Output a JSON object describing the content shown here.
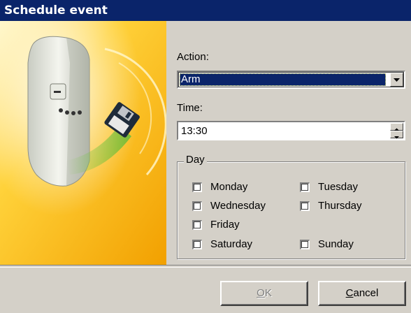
{
  "window": {
    "title": "Schedule event"
  },
  "action": {
    "label": "Action:",
    "value": "Arm"
  },
  "time": {
    "label": "Time:",
    "value": "13:30"
  },
  "day": {
    "label": "Day",
    "options": [
      {
        "label": "Monday",
        "checked": false
      },
      {
        "label": "Tuesday",
        "checked": false
      },
      {
        "label": "Wednesday",
        "checked": false
      },
      {
        "label": "Thursday",
        "checked": false
      },
      {
        "label": "Friday",
        "checked": false
      },
      {
        "label": "Saturday",
        "checked": false
      },
      {
        "label": "Sunday",
        "checked": false
      }
    ]
  },
  "buttons": {
    "ok": {
      "accel": "O",
      "rest": "K",
      "enabled": false
    },
    "cancel": {
      "accel": "C",
      "rest": "ancel",
      "enabled": true
    }
  },
  "colors": {
    "titlebar": "#0a246a",
    "face": "#d4d0c8",
    "selection": "#0a246a"
  }
}
